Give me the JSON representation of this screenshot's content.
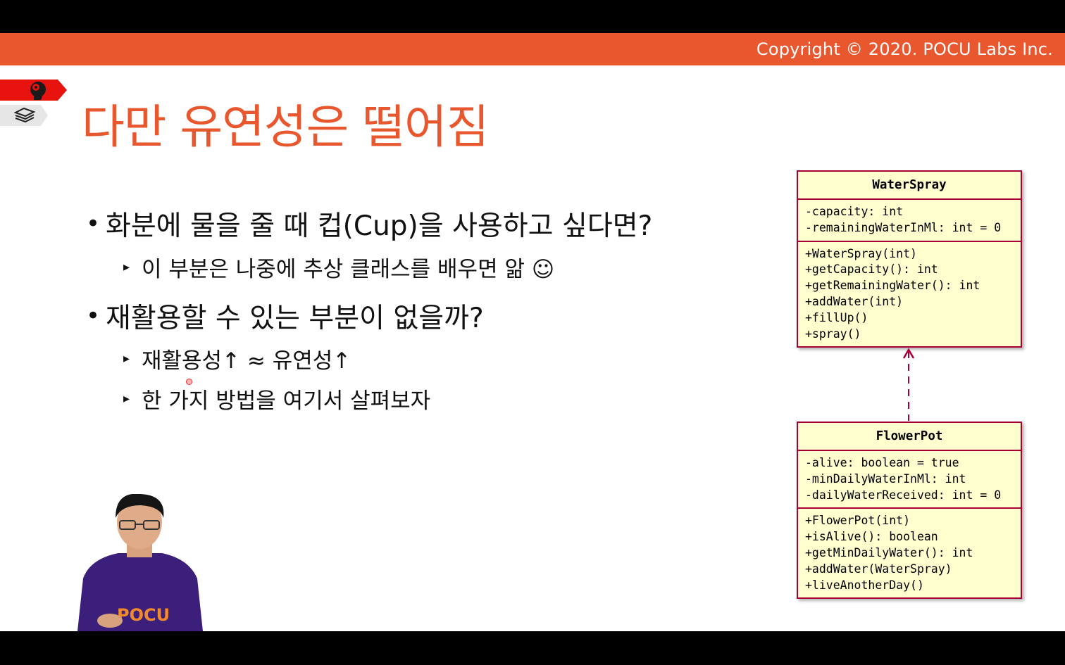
{
  "banner": {
    "copyright": "Copyright © 2020. POCU Labs Inc."
  },
  "slide": {
    "title": "다만 유연성은 떨어짐",
    "bullets": [
      {
        "text": "화분에 물을 줄 때 컵(Cup)을 사용하고 싶다면?"
      },
      {
        "text": "재활용할 수 있는 부분이 없을까?"
      }
    ],
    "sub_bullets": [
      {
        "text": "이 부분은 나중에 추상 클래스를 배우면 앎 ☺"
      },
      {
        "text": "재활용성↑ ≈ 유연성↑"
      },
      {
        "text": "한 가지 방법을 여기서 살펴보자"
      }
    ]
  },
  "uml": {
    "water_spray": {
      "name": "WaterSpray",
      "fields": [
        "-capacity: int",
        "-remainingWaterInMl: int = 0"
      ],
      "methods": [
        "+WaterSpray(int)",
        "+getCapacity(): int",
        "+getRemainingWater(): int",
        "+addWater(int)",
        "+fillUp()",
        "+spray()"
      ]
    },
    "flower_pot": {
      "name": "FlowerPot",
      "fields": [
        "-alive: boolean = true",
        "-minDailyWaterInMl: int",
        "-dailyWaterReceived: int = 0"
      ],
      "methods": [
        "+FlowerPot(int)",
        "+isAlive(): boolean",
        "+getMinDailyWater(): int",
        "+addWater(WaterSpray)",
        "+liveAnotherDay()"
      ]
    }
  },
  "icons": {
    "section_tag_active": "brain-gear-icon",
    "section_tag_inactive": "book-stack-icon"
  },
  "colors": {
    "accent": "#e8572e",
    "uml_border": "#a80036",
    "uml_fill": "#fefece"
  }
}
